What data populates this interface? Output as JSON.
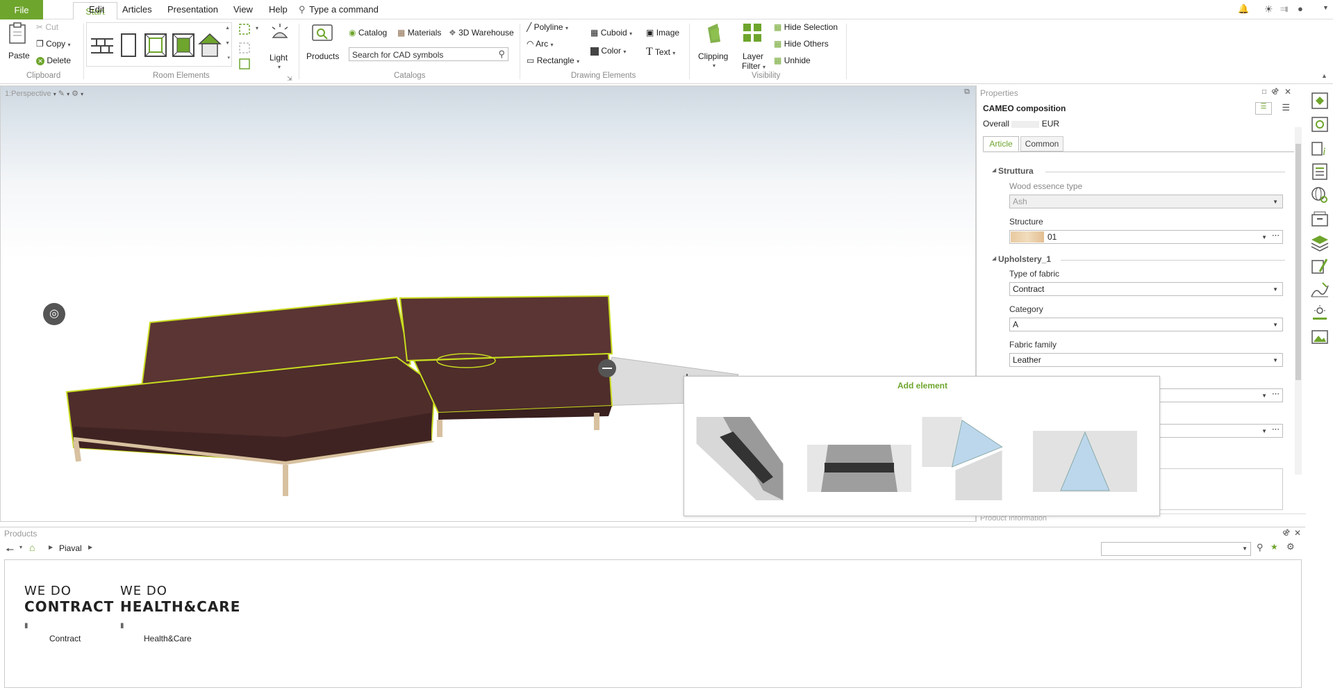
{
  "menubar": {
    "file": "File",
    "tabs": [
      "Start",
      "Edit",
      "Articles",
      "Presentation",
      "View",
      "Help"
    ],
    "command": "Type a command"
  },
  "ribbon": {
    "clipboard": {
      "paste": "Paste",
      "cut": "Cut",
      "copy": "Copy",
      "delete": "Delete",
      "group": "Clipboard"
    },
    "room_elements": {
      "group": "Room Elements"
    },
    "light": "Light",
    "products": "Products",
    "catalogs": {
      "catalog": "Catalog",
      "materials": "Materials",
      "warehouse": "3D Warehouse",
      "search_placeholder": "Search for CAD symbols",
      "group": "Catalogs"
    },
    "drawing": {
      "polyline": "Polyline",
      "arc": "Arc",
      "rectangle": "Rectangle",
      "cuboid": "Cuboid",
      "color": "Color",
      "image": "Image",
      "text": "Text",
      "group": "Drawing Elements"
    },
    "clipping": "Clipping",
    "layer_filter_1": "Layer",
    "layer_filter_2": "Filter",
    "visibility": {
      "hide_selection": "Hide Selection",
      "hide_others": "Hide Others",
      "unhide": "Unhide",
      "group": "Visibility"
    }
  },
  "viewport": {
    "label": "1:Perspective"
  },
  "properties": {
    "title": "Properties",
    "composition": "CAMEO composition",
    "overall": "Overall",
    "currency": "EUR",
    "tabs": [
      "Article",
      "Common"
    ],
    "sections": {
      "struttura": "Struttura",
      "upholstery": "Upholstery_1"
    },
    "fields": {
      "wood_label": "Wood essence type",
      "wood_value": "Ash",
      "structure_label": "Structure",
      "structure_value": "01",
      "fabric_type_label": "Type of fabric",
      "fabric_type_value": "Contract",
      "category_label": "Category",
      "category_value": "A",
      "fabric_family_label": "Fabric family",
      "fabric_family_value": "Leather"
    },
    "product_information": "Product Information"
  },
  "popup": {
    "title": "Add element"
  },
  "products": {
    "title": "Products",
    "breadcrumb": "Piaval",
    "items": [
      {
        "line1": "WE DO",
        "line2": "CONTRACT",
        "caption": "Contract"
      },
      {
        "line1": "WE DO",
        "line2": "HEALTH&CARE",
        "caption": "Health&Care"
      }
    ]
  },
  "colors": {
    "accent": "#6ea52d",
    "sofa": "#4e2d2b",
    "selection": "#c8dc1e"
  }
}
